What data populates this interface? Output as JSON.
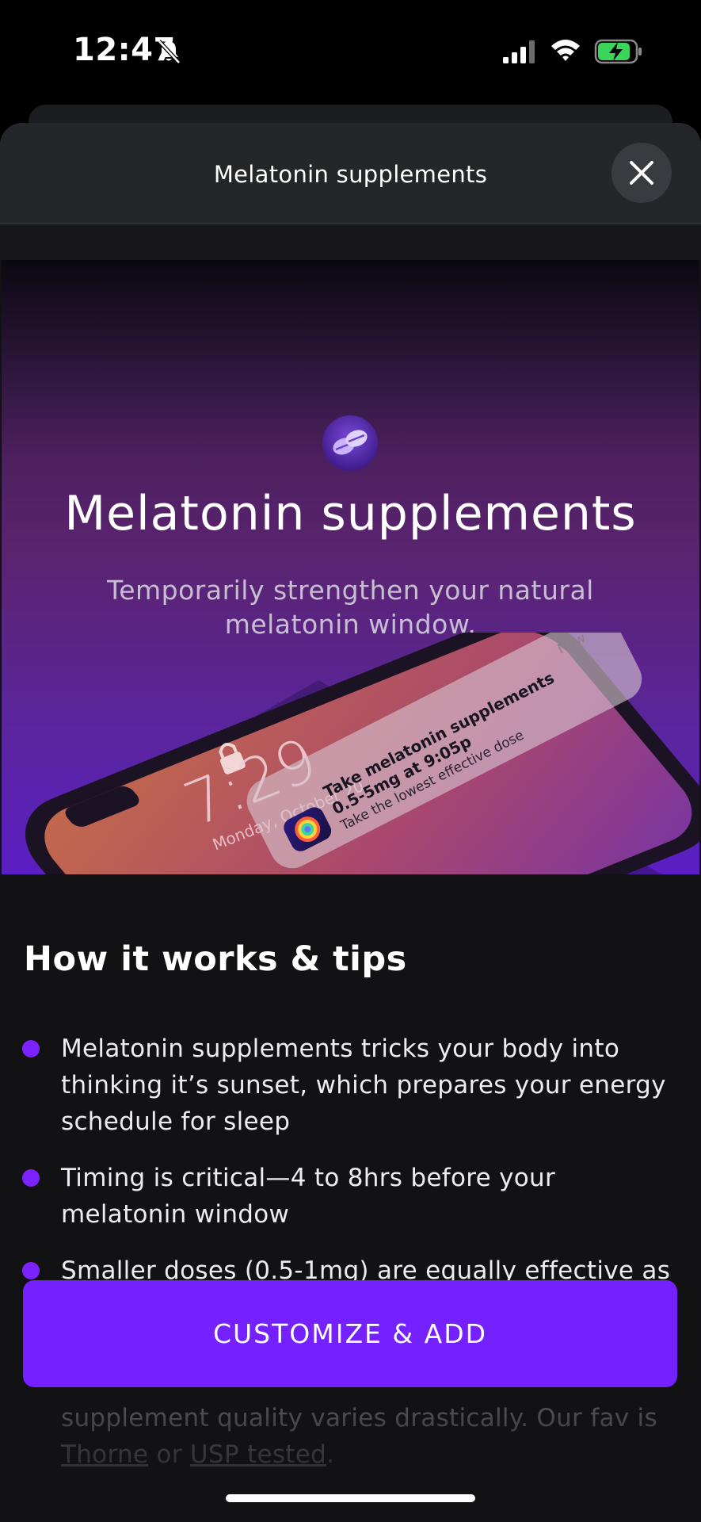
{
  "status_bar": {
    "time": "12:47",
    "icons": [
      "bell-slash-icon",
      "signal-icon",
      "wifi-icon",
      "battery-charging-icon"
    ],
    "battery_color": "#3ad65b"
  },
  "sheet": {
    "title": "Melatonin supplements",
    "close_icon": "close-icon"
  },
  "hero": {
    "icon": "pill-icon",
    "title": "Melatonin supplements",
    "subtitle": "Temporarily strengthen your natural melatonin window.",
    "illustration": {
      "lock_time": "7:29",
      "lock_date": "Monday, October 20",
      "notification": {
        "time": "Now",
        "title": "Take melatonin supplements",
        "line1": "0.5-5mg at 9:05p",
        "line2": "Take the lowest effective dose"
      }
    }
  },
  "how_it_works": {
    "heading": "How it works & tips",
    "tips": [
      {
        "text": "Melatonin supplements tricks your body into thinking it’s sunset, which prepares your energy schedule for sleep"
      },
      {
        "text": "Timing is critical—4 to 8hrs before your melatonin window"
      },
      {
        "text": "Smaller doses (0.5-1mg) are equally effective as"
      },
      {
        "text_before": "supplement quality varies drastically. Our fav is ",
        "link1": "Thorne",
        "text_middle": " or ",
        "link2": "USP tested",
        "text_after": "."
      }
    ]
  },
  "cta": {
    "label": "CUSTOMIZE & ADD",
    "color": "#7420ff"
  },
  "accent_colors": {
    "bullet": "#7b22ff",
    "hero_bottom": "#5a1ec4"
  }
}
